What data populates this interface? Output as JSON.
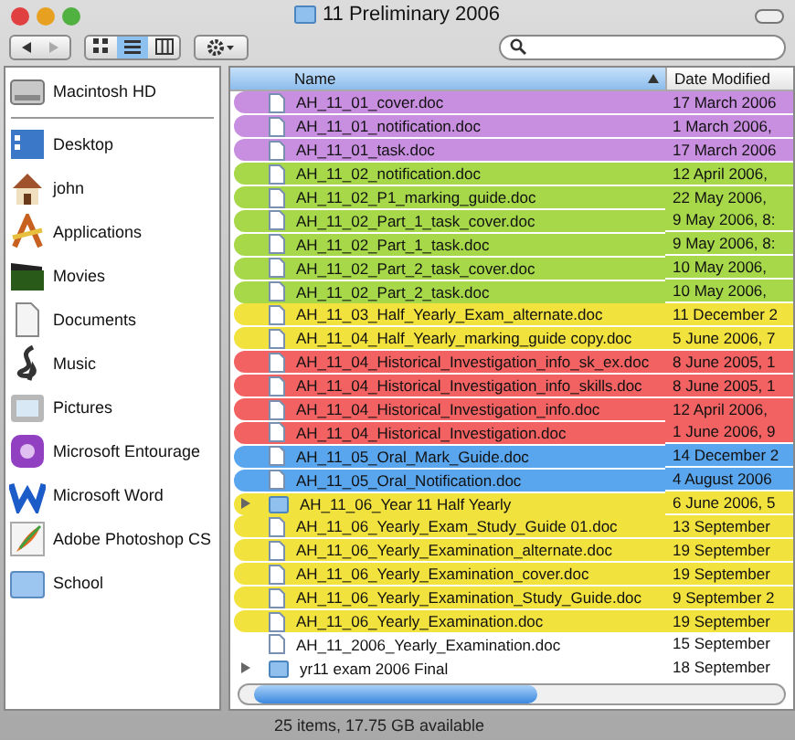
{
  "window": {
    "title": "11 Preliminary 2006"
  },
  "toolbar": {
    "views": [
      {
        "kind": "icons",
        "selected": false
      },
      {
        "kind": "list",
        "selected": true
      },
      {
        "kind": "columns",
        "selected": false
      }
    ]
  },
  "sidebar": {
    "devices": [
      {
        "label": "Macintosh HD"
      }
    ],
    "places": [
      {
        "label": "Desktop"
      },
      {
        "label": "john"
      },
      {
        "label": "Applications"
      },
      {
        "label": "Movies"
      },
      {
        "label": "Documents"
      },
      {
        "label": "Music"
      },
      {
        "label": "Pictures"
      },
      {
        "label": "Microsoft Entourage"
      },
      {
        "label": "Microsoft Word"
      },
      {
        "label": "Adobe Photoshop CS"
      },
      {
        "label": "School"
      }
    ]
  },
  "table": {
    "columns": [
      {
        "label": "Name",
        "sorted": true
      },
      {
        "label": "Date Modified",
        "sorted": false
      }
    ],
    "rows": [
      {
        "kind": "file",
        "name": "AH_11_01_cover.doc",
        "date": "17 March 2006",
        "color": "#c88ee0"
      },
      {
        "kind": "file",
        "name": "AH_11_01_notification.doc",
        "date": "1 March 2006,",
        "color": "#c88ee0"
      },
      {
        "kind": "file",
        "name": "AH_11_01_task.doc",
        "date": "17 March 2006",
        "color": "#c88ee0"
      },
      {
        "kind": "file",
        "name": "AH_11_02_notification.doc",
        "date": "12 April 2006,",
        "color": "#a6d84a"
      },
      {
        "kind": "file",
        "name": "AH_11_02_P1_marking_guide.doc",
        "date": "22 May 2006,",
        "color": "#a6d84a"
      },
      {
        "kind": "file",
        "name": "AH_11_02_Part_1_task_cover.doc",
        "date": "9 May 2006, 8:",
        "color": "#a6d84a"
      },
      {
        "kind": "file",
        "name": "AH_11_02_Part_1_task.doc",
        "date": "9 May 2006, 8:",
        "color": "#a6d84a"
      },
      {
        "kind": "file",
        "name": "AH_11_02_Part_2_task_cover.doc",
        "date": "10 May 2006,",
        "color": "#a6d84a"
      },
      {
        "kind": "file",
        "name": "AH_11_02_Part_2_task.doc",
        "date": "10 May 2006,",
        "color": "#a6d84a"
      },
      {
        "kind": "file",
        "name": "AH_11_03_Half_Yearly_Exam_alternate.doc",
        "date": "11 December 2",
        "color": "#f2e23e"
      },
      {
        "kind": "file",
        "name": "AH_11_04_Half_Yearly_marking_guide copy.doc",
        "date": "5 June 2006, 7",
        "color": "#f2e23e"
      },
      {
        "kind": "file",
        "name": "AH_11_04_Historical_Investigation_info_sk_ex.doc",
        "date": "8 June 2005, 1",
        "color": "#f26262"
      },
      {
        "kind": "file",
        "name": "AH_11_04_Historical_Investigation_info_skills.doc",
        "date": "8 June 2005, 1",
        "color": "#f26262"
      },
      {
        "kind": "file",
        "name": "AH_11_04_Historical_Investigation_info.doc",
        "date": "12 April 2006,",
        "color": "#f26262"
      },
      {
        "kind": "file",
        "name": "AH_11_04_Historical_Investigation.doc",
        "date": "1 June 2006, 9",
        "color": "#f26262"
      },
      {
        "kind": "file",
        "name": "AH_11_05_Oral_Mark_Guide.doc",
        "date": "14 December 2",
        "color": "#5aa6ee"
      },
      {
        "kind": "file",
        "name": "AH_11_05_Oral_Notification.doc",
        "date": "4 August 2006",
        "color": "#5aa6ee"
      },
      {
        "kind": "folder",
        "name": "AH_11_06_Year 11 Half Yearly",
        "date": "6 June 2006, 5",
        "color": "#f2e23e",
        "expanded": false
      },
      {
        "kind": "file",
        "name": "AH_11_06_Yearly_Exam_Study_Guide 01.doc",
        "date": "13 September",
        "color": "#f2e23e"
      },
      {
        "kind": "file",
        "name": "AH_11_06_Yearly_Examination_alternate.doc",
        "date": "19 September",
        "color": "#f2e23e"
      },
      {
        "kind": "file",
        "name": "AH_11_06_Yearly_Examination_cover.doc",
        "date": "19 September",
        "color": "#f2e23e"
      },
      {
        "kind": "file",
        "name": "AH_11_06_Yearly_Examination_Study_Guide.doc",
        "date": "9 September 2",
        "color": "#f2e23e"
      },
      {
        "kind": "file",
        "name": "AH_11_06_Yearly_Examination.doc",
        "date": "19 September",
        "color": "#f2e23e"
      },
      {
        "kind": "file",
        "name": "AH_11_2006_Yearly_Examination.doc",
        "date": "15 September"
      },
      {
        "kind": "folder",
        "name": "yr11 exam 2006 Final",
        "date": "18 September",
        "expanded": false
      }
    ]
  },
  "status_bar": {
    "text": "25 items, 17.75 GB available"
  }
}
